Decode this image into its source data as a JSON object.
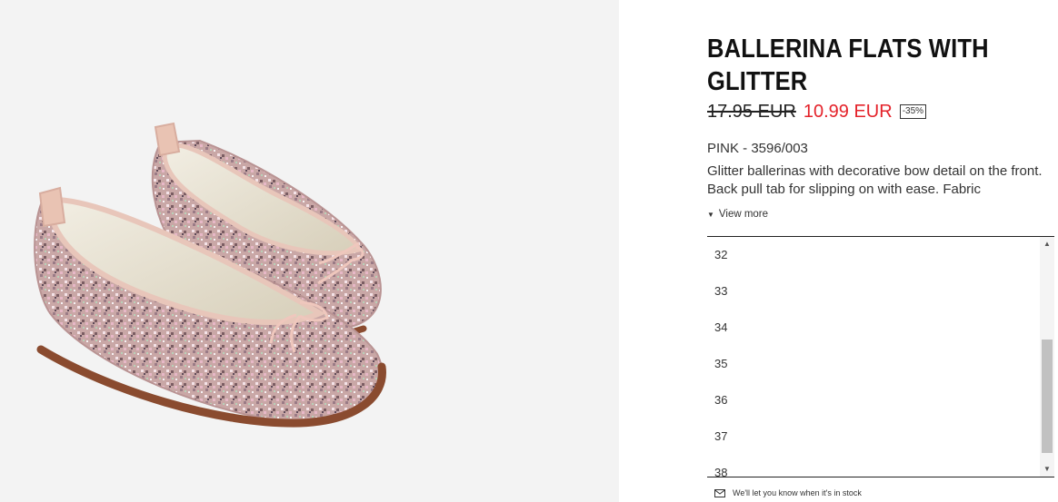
{
  "product": {
    "title": "BALLERINA FLATS WITH GLITTER",
    "old_price": "17.95 EUR",
    "new_price": "10.99 EUR",
    "discount": "-35%",
    "color_ref": "PINK - 3596/003",
    "description": "Glitter ballerinas with decorative bow detail on the front. Back pull tab for slipping on with ease. Fabric",
    "view_more": "View more"
  },
  "sizes": [
    "32",
    "33",
    "34",
    "35",
    "36",
    "37",
    "38"
  ],
  "notify": "We'll let you know when it's in stock",
  "icons": {
    "view_more": "caret-down-icon",
    "notify": "mail-icon",
    "scroll_up": "scroll-up-arrow-icon",
    "scroll_down": "scroll-down-arrow-icon"
  },
  "colors": {
    "sale": "#e4222a",
    "image_bg": "#f3f3f3"
  }
}
